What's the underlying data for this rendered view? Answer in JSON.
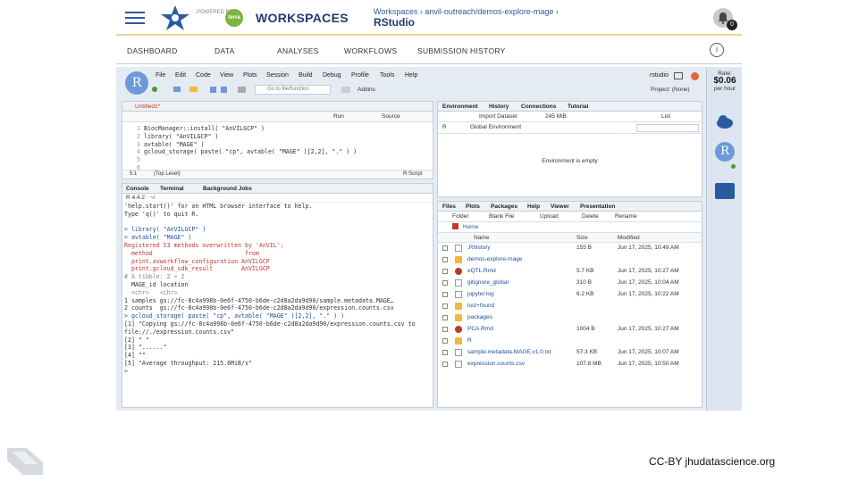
{
  "header": {
    "powered_by": "POWERED BY",
    "badge": "terra",
    "app_name": "WORKSPACES",
    "breadcrumb": "Workspaces › anvil-outreach/demos-explore-mage ›",
    "page_title": "RStudio",
    "notification_count": "0"
  },
  "nav_tabs": [
    "DASHBOARD",
    "DATA",
    "ANALYSES",
    "WORKFLOWS",
    "SUBMISSION HISTORY"
  ],
  "rstudio": {
    "menu": [
      "File",
      "Edit",
      "Code",
      "View",
      "Plots",
      "Session",
      "Build",
      "Debug",
      "Profile",
      "Tools",
      "Help"
    ],
    "user": "rstudio",
    "goto_placeholder": "Go to file/function",
    "addins": "Addins",
    "project": "Project: (None)",
    "editor": {
      "tab": "Untitled1*",
      "run": "Run",
      "source": "Source",
      "lines": [
        "BiocManager::install( \"AnVILGCP\" )",
        "library( \"AnVILGCP\" )",
        "avtable( \"MAGE\" )",
        "gcloud_storage( paste( \"cp\", avtable( \"MAGE\" )[2,2], \".\" ) )",
        "",
        ""
      ],
      "status_pos": "5:1",
      "status_scope": "(Top Level)",
      "status_type": "R Script"
    },
    "console": {
      "tabs": [
        "Console",
        "Terminal",
        "Background Jobs"
      ],
      "version": "R 4.4.2 · ~/",
      "lines": [
        {
          "t": "'help.start()' for an HTML browser interface to help.",
          "c": ""
        },
        {
          "t": "Type 'q()' to quit R.",
          "c": ""
        },
        {
          "t": "",
          "c": ""
        },
        {
          "t": "> library( \"AnVILGCP\" )",
          "c": "blue"
        },
        {
          "t": "> avtable( \"MAGE\" )",
          "c": "blue"
        },
        {
          "t": "Registered S3 methods overwritten by 'AnVIL':",
          "c": "red"
        },
        {
          "t": "  method                          from",
          "c": "red"
        },
        {
          "t": "  print.avworkflow_configuration AnVILGCP",
          "c": "red"
        },
        {
          "t": "  print.gcloud_sdk_result        AnVILGCP",
          "c": "red"
        },
        {
          "t": "# A tibble: 2 × 2",
          "c": "gray"
        },
        {
          "t": "  MAGE_id location",
          "c": ""
        },
        {
          "t": "  <chr>   <chr>",
          "c": "gray"
        },
        {
          "t": "1 samples gs://fc-8c4a998b-0e6f-4750-b6de-c2d8a2da9d90/sample.metadata.MAGE…",
          "c": ""
        },
        {
          "t": "2 counts  gs://fc-8c4a998b-0e6f-4750-b6de-c2d8a2da9d90/expression.counts.csv",
          "c": ""
        },
        {
          "t": "> gcloud_storage( paste( \"cp\", avtable( \"MAGE\" )[2,2], \".\" ) )",
          "c": "blue"
        },
        {
          "t": "[1] \"Copying gs://fc-8c4a998b-0e6f-4750-b6de-c2d8a2da9d90/expression.counts.csv to",
          "c": ""
        },
        {
          "t": "file://./expression.counts.csv\"",
          "c": ""
        },
        {
          "t": "[2] \" \"",
          "c": ""
        },
        {
          "t": "[3] \"......\"",
          "c": ""
        },
        {
          "t": "[4] \"\"",
          "c": ""
        },
        {
          "t": "[5] \"Average throughput: 215.6MiB/s\"",
          "c": ""
        },
        {
          "t": ">",
          "c": "blue"
        }
      ]
    },
    "environment": {
      "tabs": [
        "Environment",
        "History",
        "Connections",
        "Tutorial"
      ],
      "import": "Import Dataset",
      "memory": "245 MiB",
      "list": "List",
      "lang": "R",
      "scope": "Global Environment",
      "empty": "Environment is empty"
    },
    "files": {
      "tabs": [
        "Files",
        "Plots",
        "Packages",
        "Help",
        "Viewer",
        "Presentation"
      ],
      "toolbar": [
        "Folder",
        "Blank File",
        "Upload",
        "Delete",
        "Rename"
      ],
      "home": "Home",
      "col_name": "Name",
      "col_size": "Size",
      "col_modified": "Modified",
      "rows": [
        {
          "name": ".Rhistory",
          "size": "155 B",
          "modified": "Jun 17, 2025, 10:49 AM",
          "icon": "file"
        },
        {
          "name": "demos-explore-mage",
          "size": "",
          "modified": "",
          "icon": "folder"
        },
        {
          "name": "eQTL.Rmd",
          "size": "5.7 KB",
          "modified": "Jun 17, 2025, 10:27 AM",
          "icon": "rmd"
        },
        {
          "name": "gitignore_global",
          "size": "310 B",
          "modified": "Jun 17, 2025, 10:04 AM",
          "icon": "file"
        },
        {
          "name": "jupyter.log",
          "size": "6.2 KB",
          "modified": "Jun 17, 2025, 10:22 AM",
          "icon": "file"
        },
        {
          "name": "lost+found",
          "size": "",
          "modified": "",
          "icon": "folder"
        },
        {
          "name": "packages",
          "size": "",
          "modified": "",
          "icon": "folder"
        },
        {
          "name": "PCA.Rmd",
          "size": "1004 B",
          "modified": "Jun 17, 2025, 10:27 AM",
          "icon": "rmd"
        },
        {
          "name": "R",
          "size": "",
          "modified": "",
          "icon": "folder"
        },
        {
          "name": "sample.metadata.MAGE.v1.0.txt",
          "size": "57.3 KB",
          "modified": "Jun 17, 2025, 10:07 AM",
          "icon": "file"
        },
        {
          "name": "expression.counts.csv",
          "size": "107.8 MB",
          "modified": "Jun 17, 2025, 10:50 AM",
          "icon": "file"
        }
      ]
    }
  },
  "side": {
    "rate_label": "Rate:",
    "rate_value": "$0.06",
    "rate_unit": "per hour"
  },
  "footer": {
    "license": "CC-BY  jhudatascience.org"
  }
}
